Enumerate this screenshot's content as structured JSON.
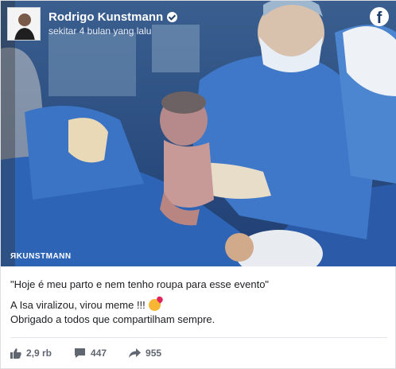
{
  "post": {
    "author": "Rodrigo Kunstmann",
    "verified": true,
    "timestamp": "sekitar 4 bulan yang lalu",
    "watermark": "ЯKUNSTMANN",
    "caption": {
      "line1": "\"Hoje é meu parto e nem tenho roupa para esse evento\"",
      "line2": "A Isa viralizou, virou meme !!!",
      "line3": "Obrigado a todos que compartilham sempre."
    },
    "stats": {
      "likes": "2,9 rb",
      "comments": "447",
      "shares": "955"
    }
  },
  "icons": {
    "platform": "facebook-icon",
    "like": "thumbs-up-icon",
    "comment": "speech-bubble-icon",
    "share": "share-arrow-icon",
    "emoji": "smiling-face-with-hearts-icon"
  },
  "colors": {
    "photo_blue": "#2f5da0",
    "stat_gray": "#606770",
    "text": "#1c1e21"
  }
}
